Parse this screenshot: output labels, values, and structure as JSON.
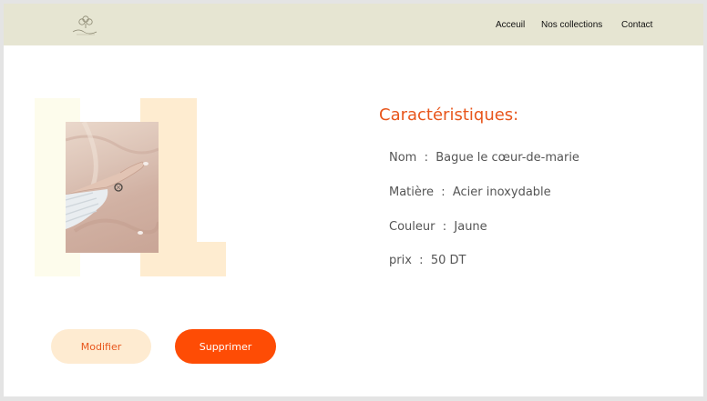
{
  "nav": {
    "links": [
      "Acceuil",
      "Nos collections",
      "Contact"
    ]
  },
  "product": {
    "section_title": "Caractéristiques:",
    "specs": [
      {
        "label": "Nom",
        "value": "Bague le cœur-de-marie"
      },
      {
        "label": "Matière",
        "value": "Acier inoxydable"
      },
      {
        "label": "Couleur",
        "value": "Jaune"
      },
      {
        "label": "prix",
        "value": "50 DT"
      }
    ],
    "separator": "  :  "
  },
  "actions": {
    "edit_label": "Modifier",
    "delete_label": "Supprimer"
  },
  "colors": {
    "navbar_bg": "#e6e5d2",
    "accent": "#e8561c",
    "delete_bg": "#fe4c05",
    "edit_bg": "#feebd1"
  }
}
